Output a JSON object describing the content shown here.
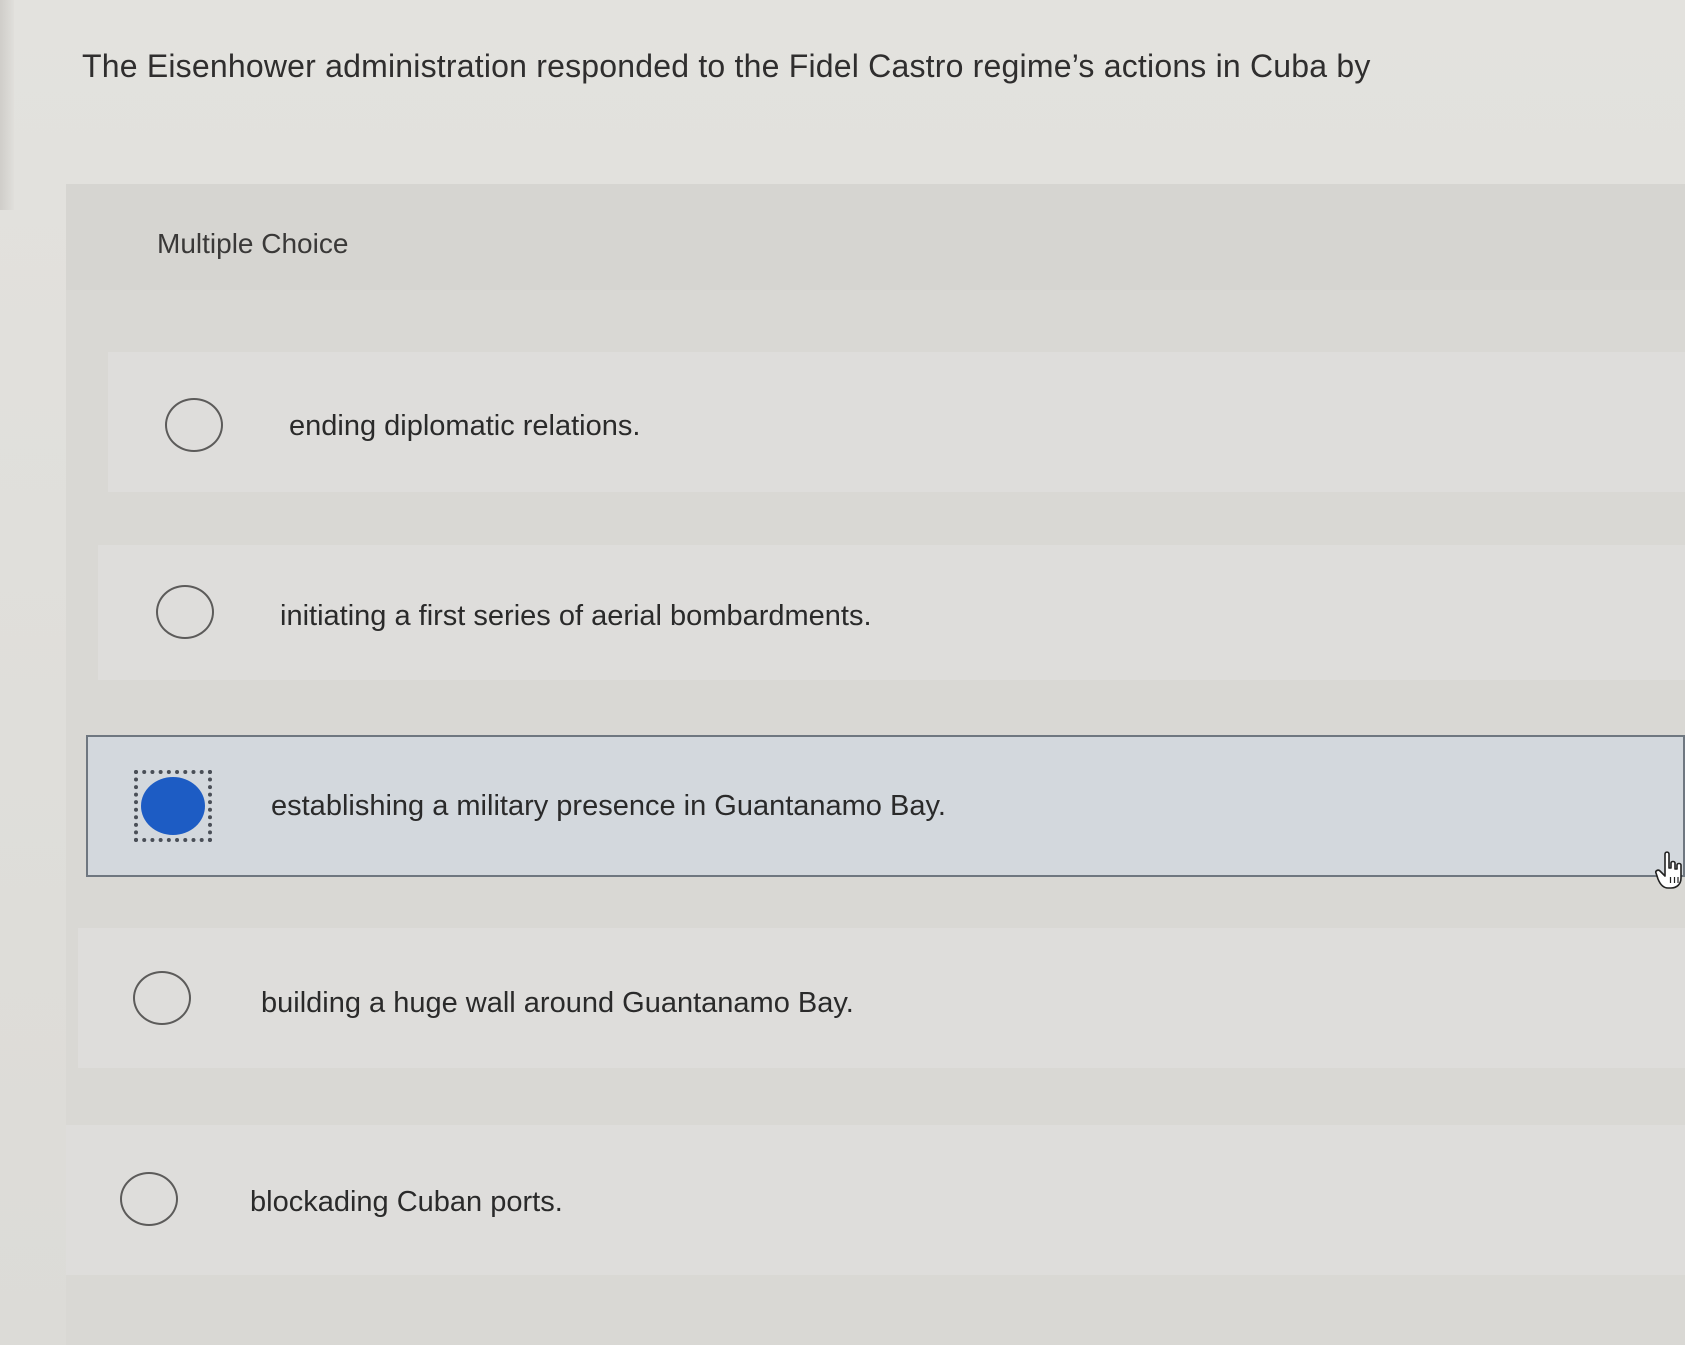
{
  "question": {
    "text": "The Eisenhower administration responded to the Fidel Castro regime’s actions in Cuba by"
  },
  "section": {
    "label": "Multiple Choice"
  },
  "options": [
    {
      "text": "ending diplomatic relations.",
      "selected": false
    },
    {
      "text": "initiating a first series of aerial bombardments.",
      "selected": false
    },
    {
      "text": "establishing a military presence in Guantanamo Bay.",
      "selected": true
    },
    {
      "text": "building a huge wall around Guantanamo Bay.",
      "selected": false
    },
    {
      "text": "blockading Cuban ports.",
      "selected": false
    }
  ],
  "colors": {
    "selected_radio": "#1d5cc4",
    "selected_background": "#d3d8dd"
  },
  "icons": {
    "cursor": "hand-pointer-icon"
  }
}
